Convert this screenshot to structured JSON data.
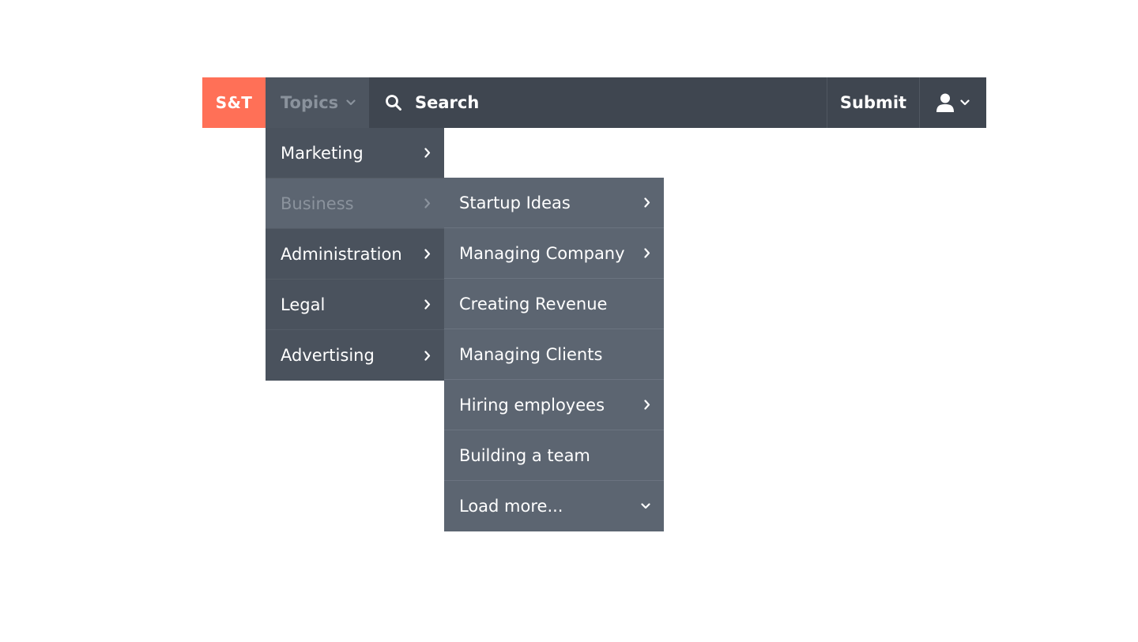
{
  "colors": {
    "brand": "#ff7057",
    "navbar": "#3f4650",
    "menu_primary": "#4a525d",
    "menu_secondary": "#5c6571",
    "muted_text": "#8a929c"
  },
  "navbar": {
    "logo": "S&T",
    "topics_label": "Topics",
    "topics_icon": "chevron-down-icon",
    "search_icon": "search-icon",
    "search_label": "Search",
    "submit_label": "Submit",
    "user_icon": "user-icon",
    "user_menu_icon": "chevron-down-icon"
  },
  "topics_menu": {
    "items": [
      {
        "label": "Marketing",
        "icon": "chevron-right-icon"
      },
      {
        "label": "Business",
        "icon": "chevron-right-icon",
        "active": true
      },
      {
        "label": "Administration",
        "icon": "chevron-right-icon"
      },
      {
        "label": "Legal",
        "icon": "chevron-right-icon"
      },
      {
        "label": "Advertising",
        "icon": "chevron-right-icon"
      }
    ]
  },
  "business_submenu": {
    "items": [
      {
        "label": "Startup Ideas",
        "icon": "chevron-right-icon"
      },
      {
        "label": "Managing Company",
        "icon": "chevron-right-icon"
      },
      {
        "label": "Creating Revenue"
      },
      {
        "label": "Managing Clients"
      },
      {
        "label": "Hiring employees",
        "icon": "chevron-right-icon"
      },
      {
        "label": "Building a team"
      },
      {
        "label": "Load more...",
        "icon": "chevron-down-icon"
      }
    ]
  }
}
